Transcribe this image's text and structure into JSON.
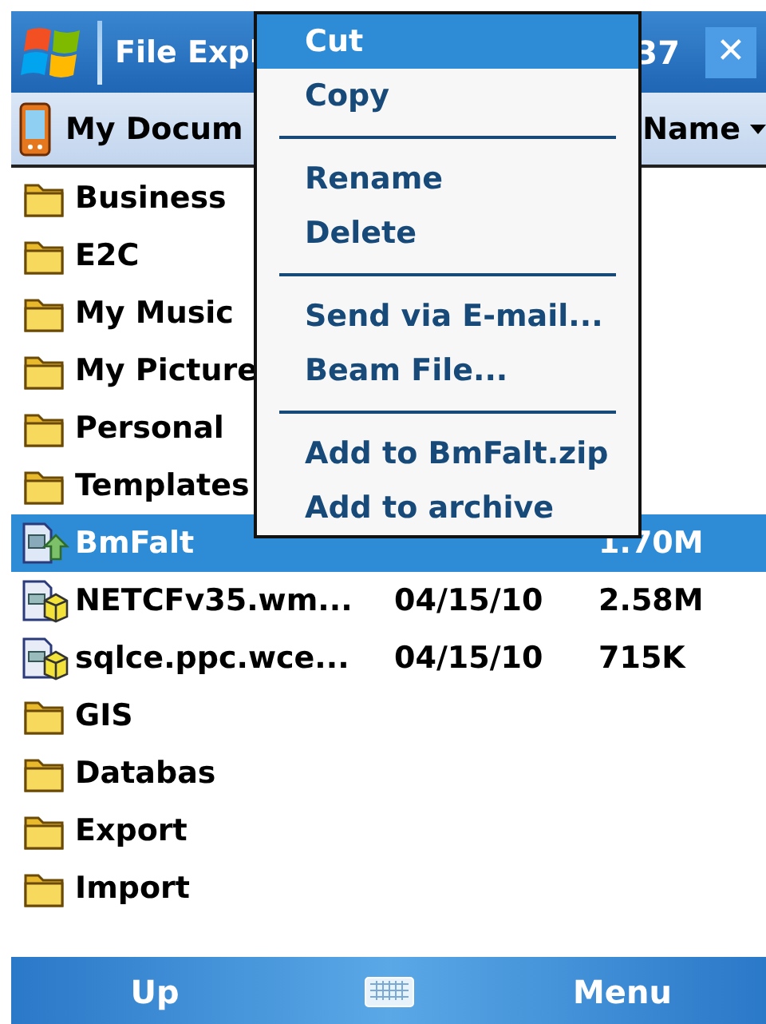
{
  "title_bar": {
    "title": "File Expl",
    "time": "37",
    "close": "✕"
  },
  "header": {
    "folder": "My Docum",
    "sort": "Name"
  },
  "rows": [
    {
      "name": "Business",
      "kind": "folder",
      "selected": false
    },
    {
      "name": "E2C",
      "kind": "folder",
      "selected": false
    },
    {
      "name": "My Music",
      "kind": "folder",
      "selected": false
    },
    {
      "name": "My Picture",
      "kind": "folder",
      "selected": false
    },
    {
      "name": "Personal",
      "kind": "folder",
      "selected": false
    },
    {
      "name": "Templates",
      "kind": "folder",
      "selected": false
    },
    {
      "name": "BmFalt",
      "kind": "program",
      "selected": true,
      "size": "1.70M"
    },
    {
      "name": "NETCFv35.wm...",
      "kind": "package",
      "selected": false,
      "date": "04/15/10",
      "size": "2.58M"
    },
    {
      "name": "sqlce.ppc.wce...",
      "kind": "package",
      "selected": false,
      "date": "04/15/10",
      "size": "715K"
    },
    {
      "name": "GIS",
      "kind": "folder",
      "selected": false
    },
    {
      "name": "Databas",
      "kind": "folder",
      "selected": false
    },
    {
      "name": "Export",
      "kind": "folder",
      "selected": false
    },
    {
      "name": "Import",
      "kind": "folder",
      "selected": false
    }
  ],
  "context_menu": [
    {
      "kind": "item",
      "label": "Cut",
      "selected": true
    },
    {
      "kind": "item",
      "label": "Copy",
      "selected": false
    },
    {
      "kind": "separator"
    },
    {
      "kind": "item",
      "label": "Rename",
      "selected": false
    },
    {
      "kind": "item",
      "label": "Delete",
      "selected": false
    },
    {
      "kind": "separator"
    },
    {
      "kind": "item",
      "label": "Send via E-mail...",
      "selected": false
    },
    {
      "kind": "item",
      "label": "Beam File...",
      "selected": false
    },
    {
      "kind": "separator"
    },
    {
      "kind": "item",
      "label": "Add to BmFalt.zip",
      "selected": false
    },
    {
      "kind": "item",
      "label": "Add to archive",
      "selected": false
    }
  ],
  "soft_keys": {
    "left": "Up",
    "right": "Menu"
  }
}
